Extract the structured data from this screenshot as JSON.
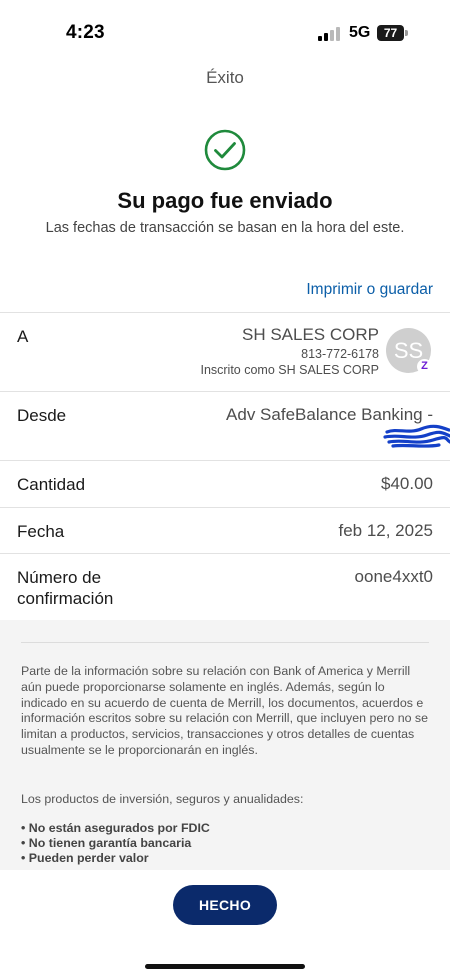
{
  "status_bar": {
    "time": "4:23",
    "network": "5G",
    "battery": "77"
  },
  "header": {
    "title": "Éxito"
  },
  "confirmation": {
    "title": "Su pago fue enviado",
    "subtitle": "Las fechas de transacción se basan en la hora del este.",
    "print_link": "Imprimir o guardar"
  },
  "details": {
    "to": {
      "label": "A",
      "name": "SH SALES CORP",
      "phone": "813-772-6178",
      "enrolled": "Inscrito como SH SALES CORP",
      "avatar_initials": "SS",
      "badge_glyph": "Z"
    },
    "from": {
      "label": "Desde",
      "value": "Adv SafeBalance Banking -"
    },
    "amount": {
      "label": "Cantidad",
      "value": "$40.00"
    },
    "date": {
      "label": "Fecha",
      "value": "feb 12, 2025"
    },
    "confirmation_number": {
      "label_line1": "Número de",
      "label_line2": "confirmación",
      "value": "oone4xxt0"
    }
  },
  "disclosure": {
    "paragraph1": "Parte de la información sobre su relación con Bank of America y Merrill aún puede proporcionarse solamente en inglés. Además, según lo indicado en su acuerdo de cuenta de Merrill, los documentos, acuerdos e información escritos sobre su relación con Merrill, que incluyen pero no se limitan a productos, servicios, transacciones y otros detalles de cuentas usualmente se le proporcionarán en inglés.",
    "paragraph2": "Los productos de inversión, seguros y anualidades:",
    "bullets": [
      "No están asegurados por FDIC",
      "No tienen garantía bancaria",
      "Pueden perder valor"
    ]
  },
  "footer": {
    "done_label": "HECHO"
  },
  "colors": {
    "success_green": "#1f8a3c",
    "link_blue": "#0b5ea8",
    "button_navy": "#0b2a6b",
    "zelle_purple": "#6d1ed4",
    "scribble_blue": "#1440c8"
  }
}
